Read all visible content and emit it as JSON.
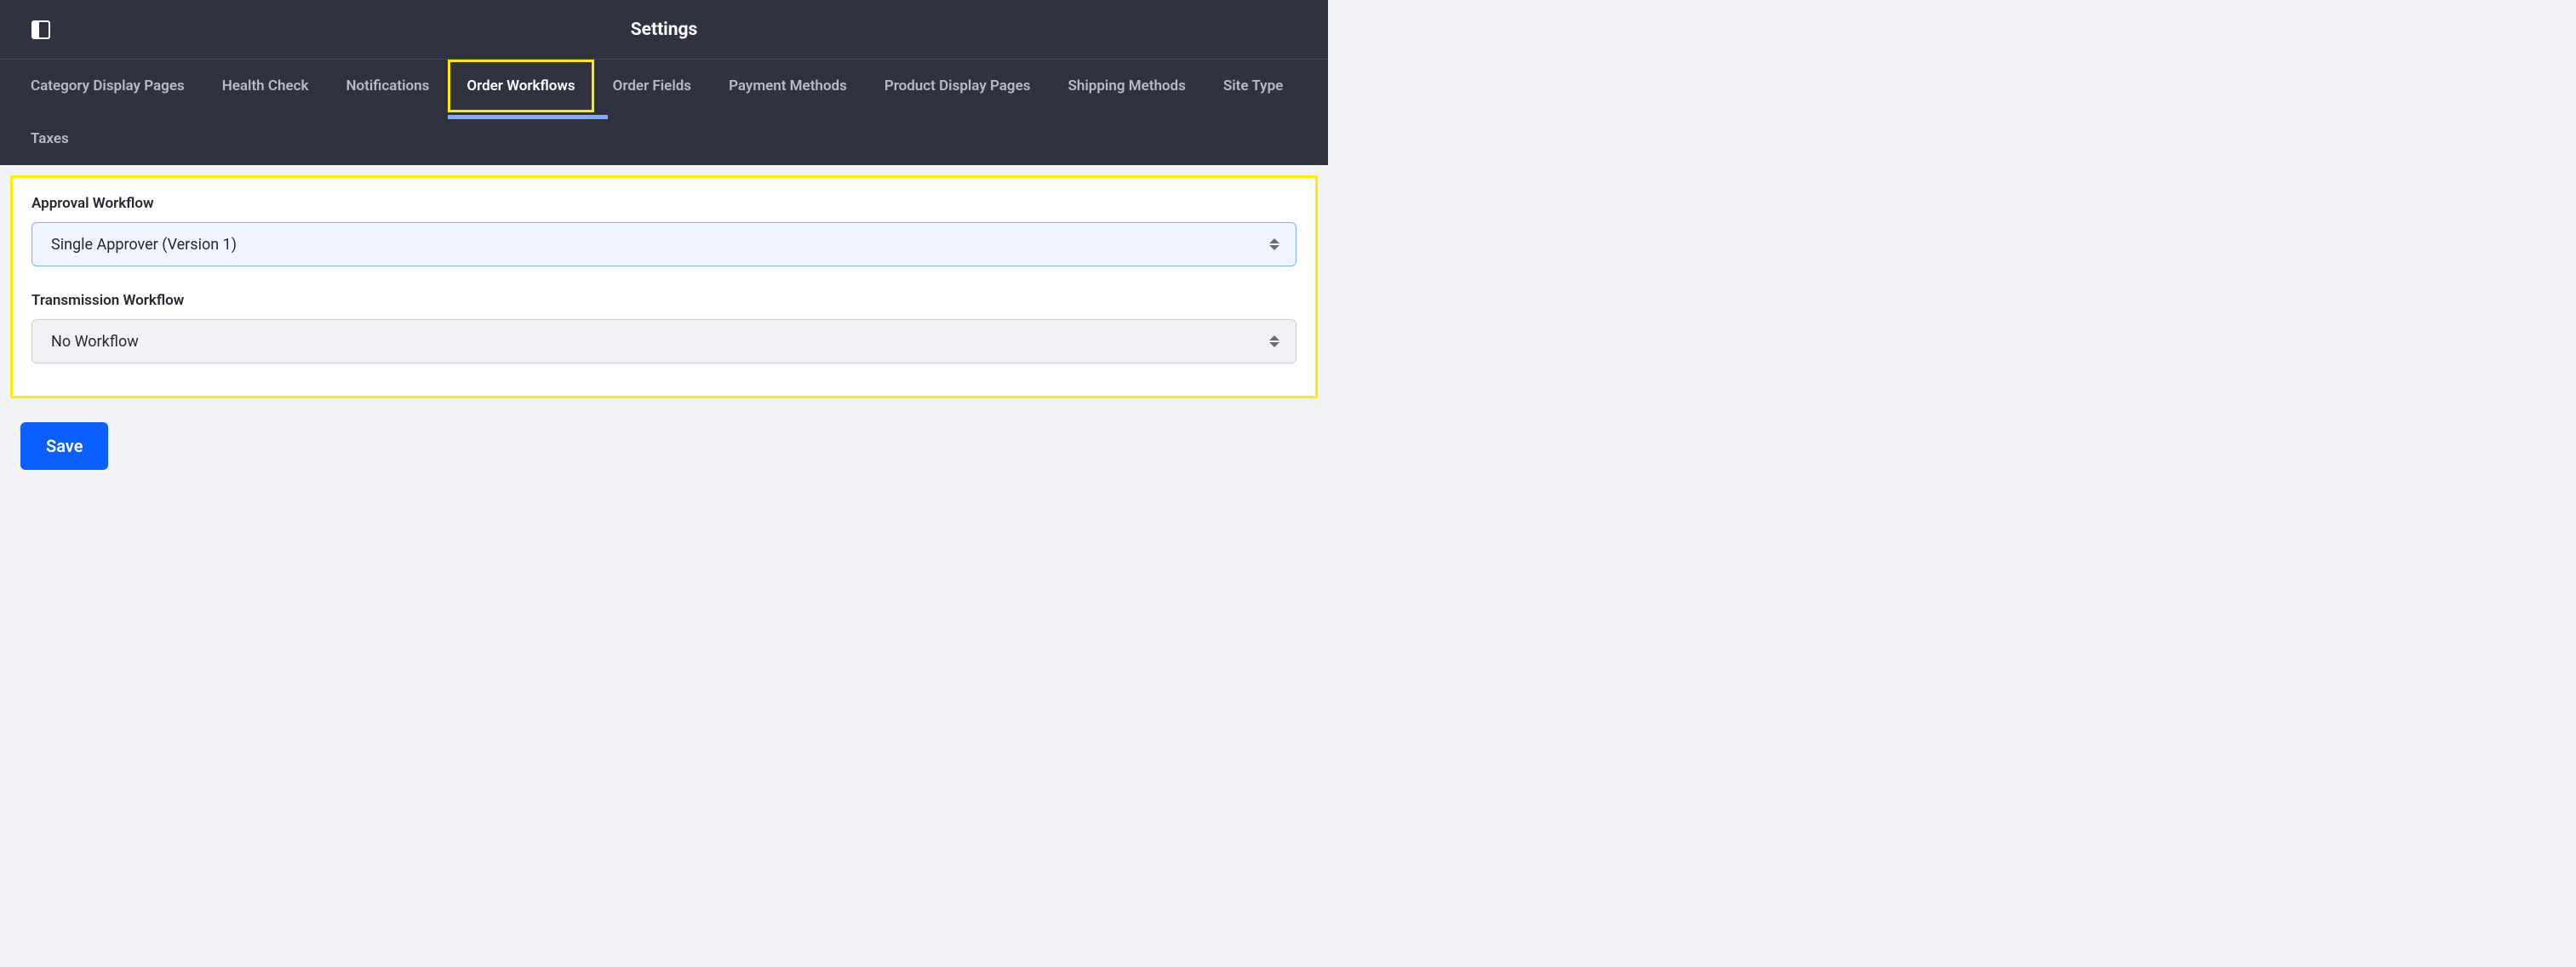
{
  "header": {
    "title": "Settings"
  },
  "tabs": {
    "items": [
      {
        "label": "Category Display Pages",
        "active": false
      },
      {
        "label": "Health Check",
        "active": false
      },
      {
        "label": "Notifications",
        "active": false
      },
      {
        "label": "Order Workflows",
        "active": true
      },
      {
        "label": "Order Fields",
        "active": false
      },
      {
        "label": "Payment Methods",
        "active": false
      },
      {
        "label": "Product Display Pages",
        "active": false
      },
      {
        "label": "Shipping Methods",
        "active": false
      },
      {
        "label": "Site Type",
        "active": false
      },
      {
        "label": "Taxes",
        "active": false
      }
    ]
  },
  "form": {
    "approval_workflow": {
      "label": "Approval Workflow",
      "value": "Single Approver (Version 1)"
    },
    "transmission_workflow": {
      "label": "Transmission Workflow",
      "value": "No Workflow"
    },
    "save_label": "Save"
  }
}
